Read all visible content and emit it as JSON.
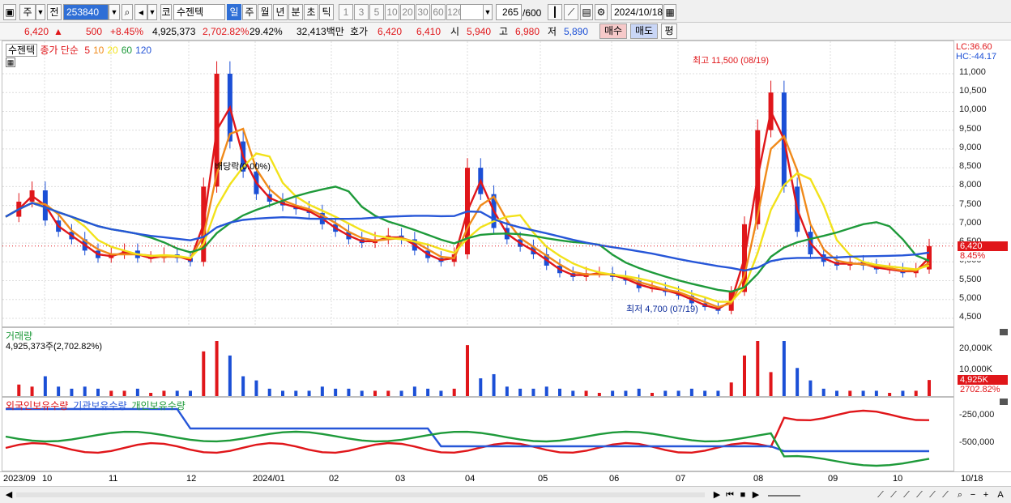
{
  "toolbar": {
    "market_label": "주",
    "prev_label": "전",
    "code": "253840",
    "market_type": "코",
    "stock_name": "수젠텍",
    "periods": [
      "일",
      "주",
      "월",
      "년",
      "분",
      "초",
      "틱"
    ],
    "minute_buttons": [
      "1",
      "3",
      "5",
      "10",
      "20",
      "30",
      "60",
      "120"
    ],
    "count": "265",
    "count_max": "/600",
    "date": "2024/10/18"
  },
  "quote": {
    "price": "6,420",
    "change_arrow": "▲",
    "change": "500",
    "change_pct": "+8.45%",
    "volume": "4,925,373",
    "volume_pct": "2,702.82%",
    "turnover_pct": "29.42%",
    "amount": "32,413백만",
    "bid_label": "호가",
    "bid1": "6,420",
    "bid2": "6,410",
    "open_label": "시",
    "open": "5,940",
    "high_label": "고",
    "high": "6,980",
    "low_label": "저",
    "low": "5,890",
    "buy_label": "매수",
    "sell_label": "매도",
    "avg_label": "평"
  },
  "price_panel": {
    "stock_tag": "수젠텍",
    "ma_title": "종가 단순",
    "ma_periods": [
      "5",
      "10",
      "20",
      "60",
      "120"
    ],
    "ma_colors": [
      "#e0161a",
      "#f08a1a",
      "#f2e21a",
      "#1e9a3a",
      "#2656d8"
    ],
    "lc_text": "LC:36.60",
    "hc_text": "HC:-44.17",
    "high_annotation": "최고 11,500 (08/19)",
    "low_annotation": "최저 4,700 (07/19)",
    "dividend_annotation": "배당락(0.00%)",
    "price_ticks": [
      "11,000",
      "10,500",
      "10,000",
      "9,500",
      "9,000",
      "8,500",
      "8,000",
      "7,500",
      "7,000",
      "6,500",
      "6,000",
      "5,500",
      "5,000",
      "4,500"
    ],
    "current_price_badge": "6,420",
    "current_pct_badge": "8.45%"
  },
  "volume_panel": {
    "title": "거래량",
    "subtitle": "4,925,373주(2,702.82%)",
    "ticks": [
      "20,000K",
      "10,000K"
    ],
    "current_badge": "4,925K",
    "pct_badge": "2702.82%"
  },
  "holding_panel": {
    "titles": [
      "외국인보유수량",
      "기관보유수량",
      "개인보유수량"
    ],
    "title_colors": [
      "#e0161a",
      "#2656d8",
      "#1e9a3a"
    ],
    "ticks": [
      "-250,000",
      "-500,000"
    ]
  },
  "x_axis": {
    "labels": [
      "2023/09",
      "10",
      "11",
      "12",
      "2024/01",
      "02",
      "03",
      "04",
      "05",
      "06",
      "07",
      "08",
      "09",
      "10",
      "10/18"
    ]
  },
  "chart_data": {
    "type": "candlestick",
    "title": "수젠텍 (253840) 일봉",
    "price_range": [
      4500,
      11500
    ],
    "high": {
      "value": 11500,
      "date": "08/19"
    },
    "low": {
      "value": 4700,
      "date": "07/19"
    },
    "last": {
      "close": 6420,
      "open": 5940,
      "high": 6980,
      "low": 5890,
      "date": "2024/10/18"
    },
    "close_series_approx": [
      7200,
      7600,
      7900,
      7100,
      6800,
      6600,
      6300,
      6100,
      6200,
      6300,
      6100,
      6100,
      6200,
      6100,
      6000,
      8000,
      11000,
      9200,
      8400,
      7800,
      7600,
      7500,
      7400,
      7300,
      7000,
      6800,
      6600,
      6500,
      6600,
      6700,
      6600,
      6300,
      6100,
      6000,
      6200,
      8500,
      7800,
      6900,
      6600,
      6400,
      6200,
      5900,
      5700,
      5600,
      5700,
      5700,
      5600,
      5500,
      5300,
      5300,
      5200,
      5100,
      4900,
      4800,
      4700,
      5200,
      7000,
      9500,
      10500,
      8000,
      6800,
      6200,
      6000,
      5900,
      6000,
      5900,
      5800,
      5800,
      5700,
      5800,
      6420
    ],
    "volume_unit": "K",
    "volume_last": 4925
  }
}
